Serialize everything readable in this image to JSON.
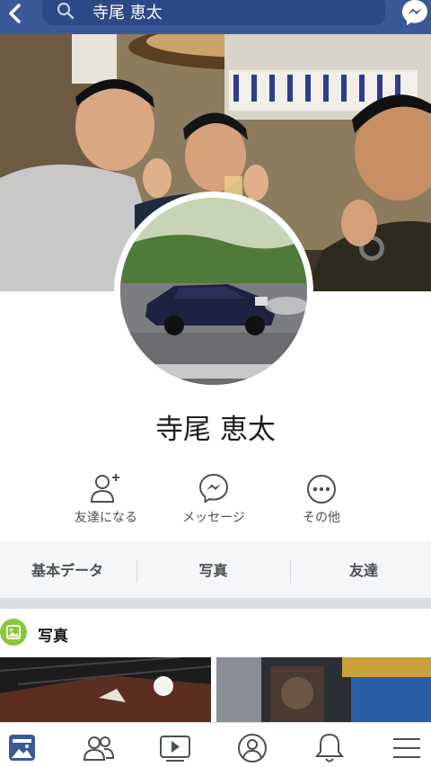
{
  "search": {
    "text": "寺尾 恵太"
  },
  "profile": {
    "name": "寺尾 恵太"
  },
  "actions": [
    {
      "label": "友達になる",
      "icon": "add-friend-icon"
    },
    {
      "label": "メッセージ",
      "icon": "messenger-icon"
    },
    {
      "label": "その他",
      "icon": "more-icon"
    }
  ],
  "tabs": [
    {
      "label": "基本データ"
    },
    {
      "label": "写真"
    },
    {
      "label": "友達"
    }
  ],
  "photos_section": {
    "title": "写真"
  },
  "bottom_nav": [
    "news-feed-icon",
    "friends-icon",
    "watch-icon",
    "profile-icon",
    "notifications-icon",
    "menu-icon"
  ],
  "colors": {
    "brand": "#3b5998",
    "photo_badge": "#8ac73a",
    "active_nav": "#3b5998"
  }
}
